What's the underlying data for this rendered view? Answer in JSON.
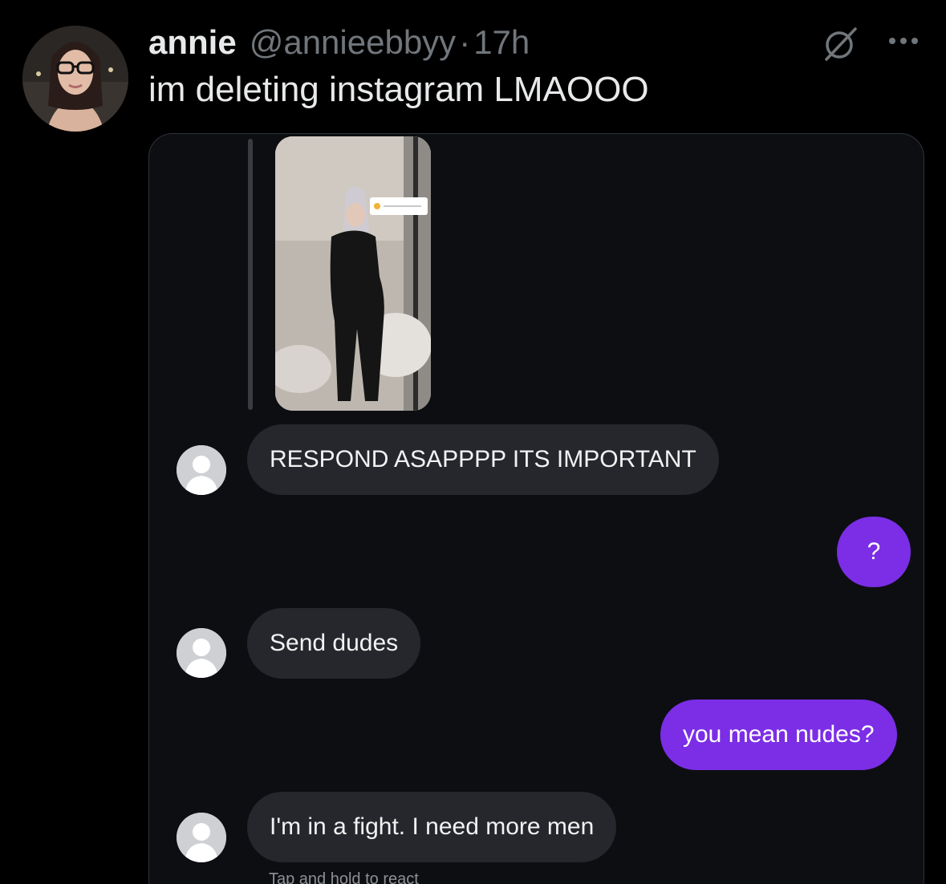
{
  "tweet": {
    "author": {
      "display_name": "annie",
      "handle": "@annieebbyy",
      "separator": "·",
      "time": "17h"
    },
    "text": "im deleting instagram LMAOOO",
    "icons": {
      "grok": "grok-icon",
      "more": "more-options-icon"
    }
  },
  "dm_screenshot": {
    "messages": [
      {
        "from": "them",
        "text": "RESPOND ASAPPPP ITS IMPORTANT"
      },
      {
        "from": "me",
        "text": "?"
      },
      {
        "from": "them",
        "text": "Send dudes"
      },
      {
        "from": "me",
        "text": "you mean nudes?"
      },
      {
        "from": "them",
        "text": "I'm in a fight. I need more men"
      }
    ],
    "react_hint": "Tap and hold to react",
    "colors": {
      "incoming_bubble": "#26272c",
      "outgoing_bubble": "#7b2ee6",
      "background": "#0d0e12"
    }
  }
}
